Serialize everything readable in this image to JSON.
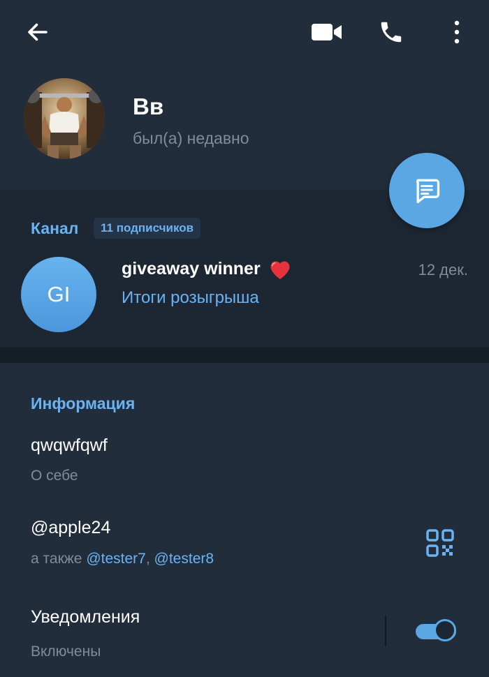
{
  "profile": {
    "name": "Вв",
    "status": "был(а) недавно"
  },
  "channel": {
    "label": "Канал",
    "subscribers": "11 подписчиков",
    "avatar_initials": "GI",
    "post_title": "giveaway winner",
    "post_emoji": "heart-icon",
    "post_subtitle": "Итоги розыгрыша",
    "post_date": "12 дек."
  },
  "info": {
    "title": "Информация",
    "bio": "qwqwfqwf",
    "bio_label": "О себе",
    "username": "@apple24",
    "also_prefix": "а также",
    "also_users": [
      "@tester7",
      "@tester8"
    ],
    "notifications_title": "Уведомления",
    "notifications_status": "Включены",
    "notifications_enabled": true
  },
  "colors": {
    "accent": "#6ab3f3",
    "fab": "#5aa7e4",
    "background": "#1d2733",
    "header": "#212d3b"
  },
  "icons": [
    "back-arrow-icon",
    "video-call-icon",
    "phone-icon",
    "more-vertical-icon",
    "message-icon",
    "qr-code-icon"
  ]
}
